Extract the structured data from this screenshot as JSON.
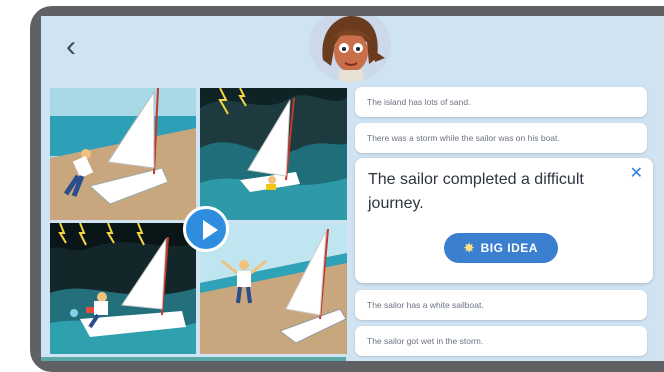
{
  "header": {
    "back_icon": "chevron-left-icon",
    "back_glyph": "‹"
  },
  "comic": {
    "play_icon": "play-icon"
  },
  "cards": [
    {
      "text": "The island has lots of sand."
    },
    {
      "text": "There was a storm while the sailor was on his boat."
    },
    {
      "text": "The sailor has a white sailboat."
    },
    {
      "text": "The sailor got wet in the storm."
    }
  ],
  "selected_card": {
    "text": "The sailor completed a difficult journey.",
    "close_glyph": "✕",
    "badge_label": "BIG IDEA",
    "badge_icon": "lightbulb-icon",
    "badge_icon_glyph": "✸"
  },
  "colors": {
    "screen_bg": "#cfe3f3",
    "accent_blue": "#3a7fd0",
    "play_blue": "#2f8de0"
  }
}
